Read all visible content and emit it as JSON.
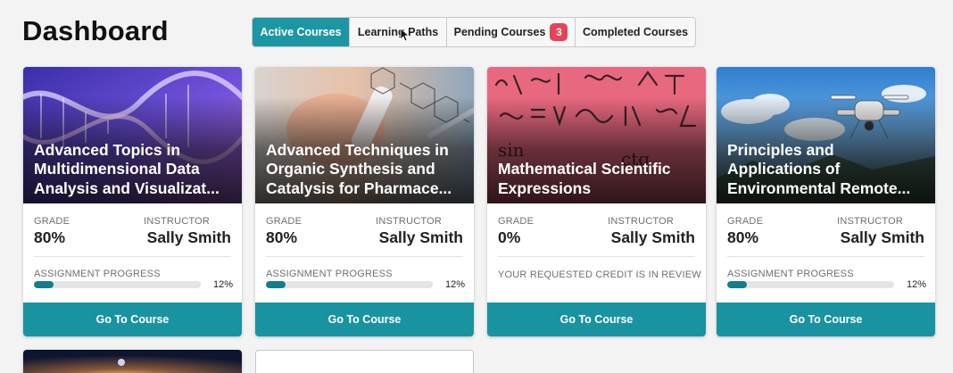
{
  "page": {
    "title": "Dashboard"
  },
  "tabs": [
    {
      "label": "Active Courses",
      "active": true
    },
    {
      "label": "Learning Paths",
      "active": false
    },
    {
      "label": "Pending Courses",
      "badge": "3",
      "active": false
    },
    {
      "label": "Completed Courses",
      "active": false
    }
  ],
  "colors": {
    "accent": "#1a93a1",
    "badge": "#e84259",
    "progress_fill": "#127f8a"
  },
  "courses": [
    {
      "title": "Advanced Topics in Multidimensional Data Analysis and Visualizat...",
      "image": "dna-helix-image",
      "grade_label": "GRADE",
      "grade": "80%",
      "instructor_label": "INSTRUCTOR",
      "instructor": "Sally Smith",
      "progress_label": "ASSIGNMENT PROGRESS",
      "progress": "12%",
      "progress_value": 0.12,
      "button": "Go To Course"
    },
    {
      "title": "Advanced Techniques in Organic Synthesis and Catalysis for Pharmace...",
      "image": "chemistry-lab-image",
      "grade_label": "GRADE",
      "grade": "80%",
      "instructor_label": "INSTRUCTOR",
      "instructor": "Sally Smith",
      "progress_label": "ASSIGNMENT PROGRESS",
      "progress": "12%",
      "progress_value": 0.12,
      "button": "Go To Course"
    },
    {
      "title": "Mathematical Scientific Expressions",
      "image": "math-formulas-image",
      "grade_label": "GRADE",
      "grade": "0%",
      "instructor_label": "INSTRUCTOR",
      "instructor": "Sally Smith",
      "note": "YOUR REQUESTED CREDIT IS IN REVIEW",
      "button": "Go To Course"
    },
    {
      "title": "Principles and Applications of Environmental Remote...",
      "image": "drone-sky-image",
      "grade_label": "GRADE",
      "grade": "80%",
      "instructor_label": "INSTRUCTOR",
      "instructor": "Sally Smith",
      "progress_label": "ASSIGNMENT PROGRESS",
      "progress": "12%",
      "progress_value": 0.12,
      "button": "Go To Course"
    }
  ],
  "partial_cards": [
    {
      "image": "space-image"
    },
    {
      "image": "blank"
    }
  ]
}
